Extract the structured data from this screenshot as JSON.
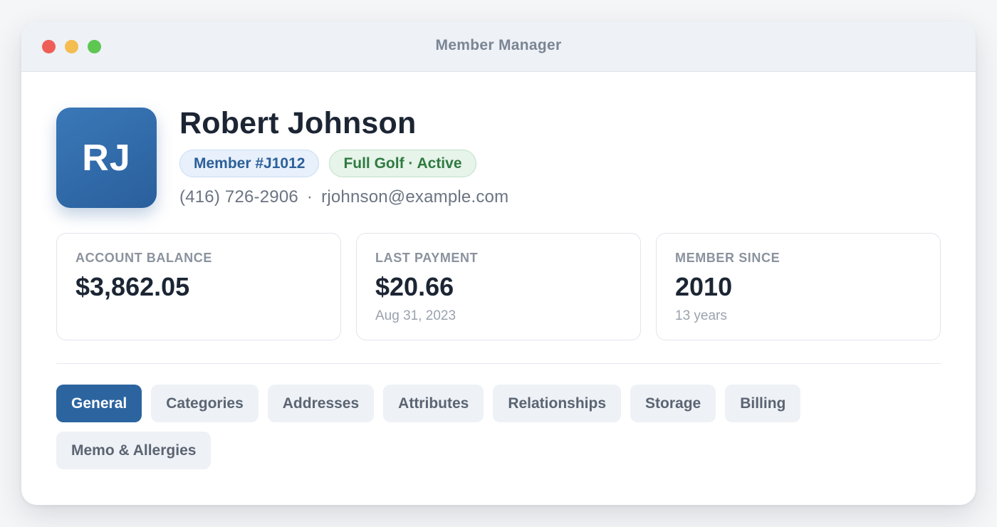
{
  "window": {
    "title": "Member Manager"
  },
  "member": {
    "initials": "RJ",
    "name": "Robert Johnson",
    "member_badge": "Member #J1012",
    "plan_badge": "Full Golf · Active",
    "phone": "(416) 726-2906",
    "contact_separator": "·",
    "email": "rjohnson@example.com"
  },
  "stats": [
    {
      "label": "ACCOUNT BALANCE",
      "value": "$3,862.05",
      "sub": ""
    },
    {
      "label": "LAST PAYMENT",
      "value": "$20.66",
      "sub": "Aug 31, 2023"
    },
    {
      "label": "MEMBER SINCE",
      "value": "2010",
      "sub": "13 years"
    }
  ],
  "tabs": [
    {
      "label": "General",
      "active": true
    },
    {
      "label": "Categories",
      "active": false
    },
    {
      "label": "Addresses",
      "active": false
    },
    {
      "label": "Attributes",
      "active": false
    },
    {
      "label": "Relationships",
      "active": false
    },
    {
      "label": "Storage",
      "active": false
    },
    {
      "label": "Billing",
      "active": false
    },
    {
      "label": "Memo & Allergies",
      "active": false
    }
  ],
  "colors": {
    "accent": "#2c64a0",
    "avatar": "#3a78b8",
    "member_badge_text": "#2c5f98",
    "plan_badge_text": "#2f7a40",
    "close": "#ee5f57",
    "minimize": "#f4bd4f",
    "zoom": "#5dc752"
  }
}
